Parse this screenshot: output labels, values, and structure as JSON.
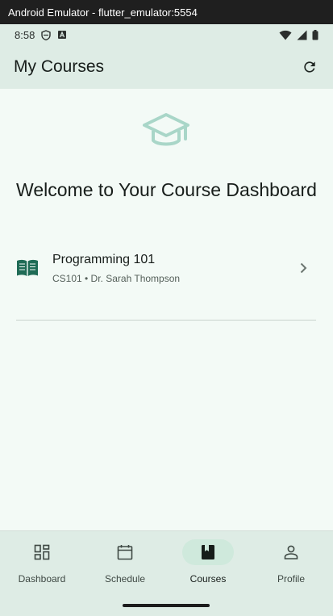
{
  "window": {
    "title": "Android Emulator - flutter_emulator:5554"
  },
  "status_bar": {
    "time": "8:58"
  },
  "app_bar": {
    "title": "My Courses",
    "refresh_icon": "refresh-icon"
  },
  "hero": {
    "icon": "graduation-cap-icon",
    "welcome_text": "Welcome to Your Course Dashboard"
  },
  "courses": [
    {
      "name": "Programming 101",
      "subtitle": "CS101 • Dr. Sarah Thompson",
      "icon": "book-open-icon"
    }
  ],
  "nav": {
    "items": [
      {
        "label": "Dashboard",
        "icon": "dashboard-icon"
      },
      {
        "label": "Schedule",
        "icon": "calendar-icon"
      },
      {
        "label": "Courses",
        "icon": "book-icon"
      },
      {
        "label": "Profile",
        "icon": "person-icon"
      }
    ],
    "active": "Courses"
  },
  "colors": {
    "accent": "#1f6b56",
    "surface": "#f3faf6",
    "bar": "#deece5",
    "active_pill": "#cfe9dc",
    "hero_icon": "#a9d6c8"
  }
}
